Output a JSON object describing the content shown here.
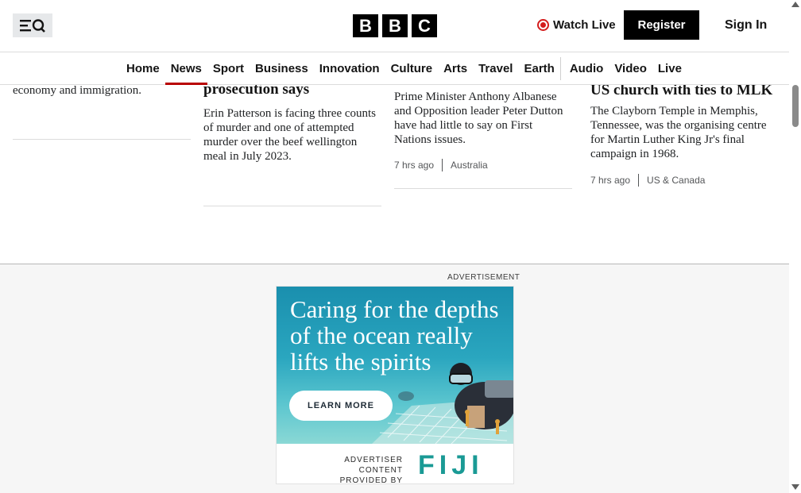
{
  "header": {
    "logo_letters": [
      "B",
      "B",
      "C"
    ],
    "watch_live": "Watch Live",
    "register": "Register",
    "sign_in": "Sign In"
  },
  "nav": {
    "items": [
      {
        "label": "Home",
        "active": false
      },
      {
        "label": "News",
        "active": true
      },
      {
        "label": "Sport",
        "active": false
      },
      {
        "label": "Business",
        "active": false
      },
      {
        "label": "Innovation",
        "active": false
      },
      {
        "label": "Culture",
        "active": false
      },
      {
        "label": "Arts",
        "active": false
      },
      {
        "label": "Travel",
        "active": false
      },
      {
        "label": "Earth",
        "active": false
      },
      {
        "label": "Audio",
        "active": false
      },
      {
        "label": "Video",
        "active": false
      },
      {
        "label": "Live",
        "active": false
      }
    ]
  },
  "articles": [
    {
      "summary": "economy and immigration."
    },
    {
      "headline_tail": "prosecution says",
      "summary": "Erin Patterson is facing three counts of murder and one of attempted murder over the beef wellington meal in July 2023."
    },
    {
      "summary": "Prime Minister Anthony Albanese and Opposition leader Peter Dutton have had little to say on First Nations issues.",
      "time": "7 hrs ago",
      "section": "Australia"
    },
    {
      "headline_tail": "US church with ties to MLK",
      "summary": "The Clayborn Temple in Memphis, Tennessee, was the organising centre for Martin Luther King Jr's final campaign in 1968.",
      "time": "7 hrs ago",
      "section": "US & Canada"
    }
  ],
  "ad": {
    "label": "ADVERTISEMENT",
    "headline": "Caring for the depths of the ocean really lifts the spirits",
    "cta": "LEARN MORE",
    "advertiser_line1": "ADVERTISER CONTENT",
    "advertiser_line2": "PROVIDED BY",
    "brand": "FIJI"
  },
  "colors": {
    "accent": "#b80000",
    "live": "#d41d1d",
    "brand_teal": "#1a9a95"
  }
}
